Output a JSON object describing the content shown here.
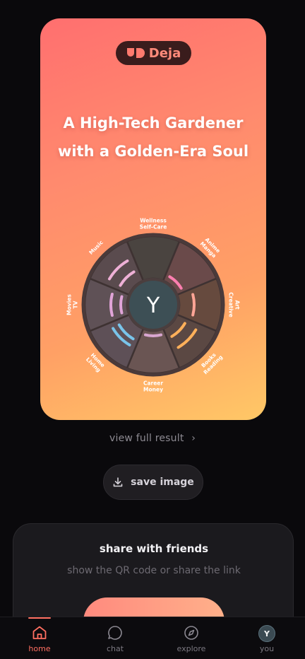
{
  "brand": {
    "name": "Deja",
    "logo": "deja-logo-icon"
  },
  "result": {
    "title_line1": "A High-Tech Gardener",
    "title_line2": "with a Golden-Era Soul",
    "avatar_initial": "Y",
    "wheel_categories": [
      {
        "line1": "Wellness",
        "line2": "Self-Care"
      },
      {
        "line1": "Anime",
        "line2": "Manga"
      },
      {
        "line1": "Art",
        "line2": "Creative"
      },
      {
        "line1": "Books",
        "line2": "Reading"
      },
      {
        "line1": "Career",
        "line2": "Money"
      },
      {
        "line1": "Home",
        "line2": "Living"
      },
      {
        "line1": "Movies",
        "line2": "TV"
      },
      {
        "line1": "Music",
        "line2": ""
      }
    ]
  },
  "actions": {
    "view_full_result": "view full result",
    "view_chevron": "›",
    "save_image": "save image",
    "save_icon": "download-icon"
  },
  "share": {
    "title": "share with friends",
    "subtitle": "show the QR code or share the link"
  },
  "tabbar": {
    "tabs": [
      {
        "label": "home",
        "icon": "home-icon",
        "active": true
      },
      {
        "label": "chat",
        "icon": "chat-bubble-icon",
        "active": false
      },
      {
        "label": "explore",
        "icon": "compass-icon",
        "active": false
      },
      {
        "label": "you",
        "icon": "avatar",
        "active": false,
        "initial": "Y"
      }
    ]
  },
  "colors": {
    "accent": "#ff6f61",
    "card_gradient_start": "#ff6f6f",
    "card_gradient_end": "#ffc866",
    "background": "#0a090c"
  }
}
